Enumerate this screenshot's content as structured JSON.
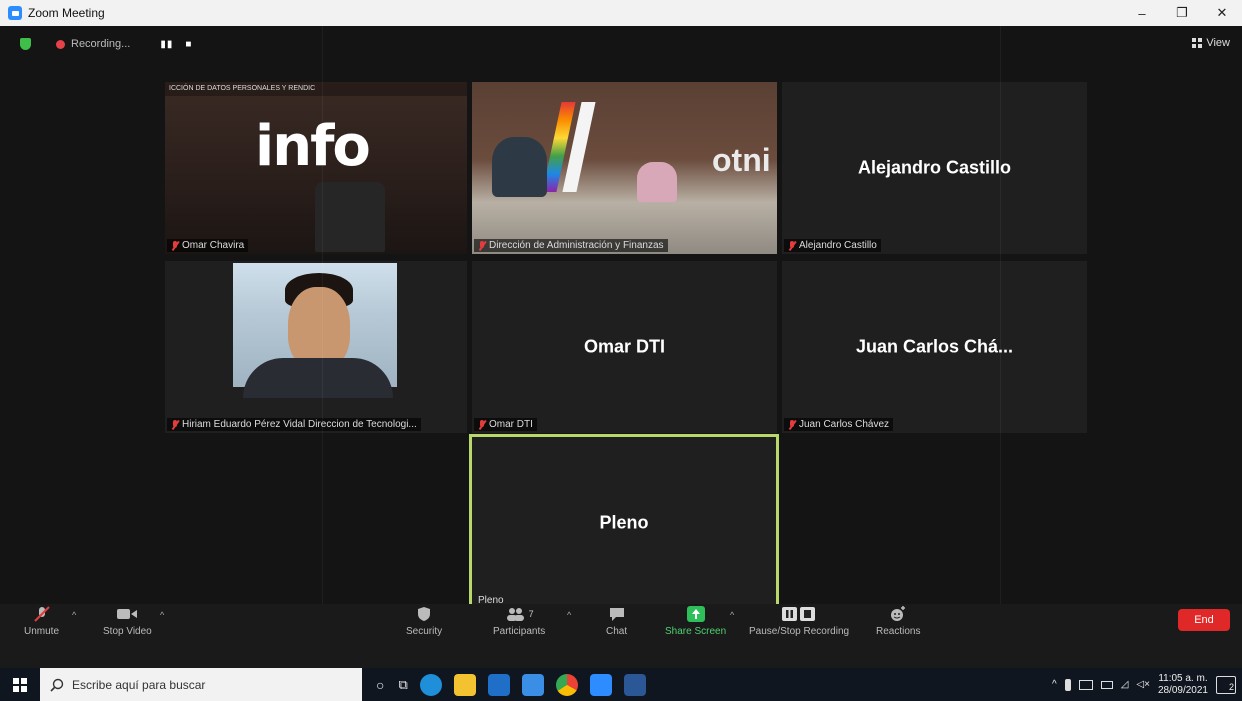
{
  "window": {
    "title": "Zoom Meeting",
    "minimize": "–",
    "restore": "❐",
    "close": "✕"
  },
  "topbar": {
    "recording_label": "Recording...",
    "pause_icon": "▮▮",
    "stop_icon": "■",
    "view_label": "View"
  },
  "tiles": {
    "omar_chavira": {
      "name": "Omar Chavira",
      "banner": "ICCIÓN DE DATOS PERSONALES Y RENDIC",
      "logo": "info"
    },
    "direccion": {
      "name": "Dirección de Administración y Finanzas",
      "sign": "otni"
    },
    "alejandro": {
      "center_name": "Alejandro Castillo",
      "name": "Alejandro Castillo"
    },
    "hiriam": {
      "name": "Hiriam Eduardo Pérez Vidal Direccion de Tecnologi..."
    },
    "omar_dti": {
      "center_name": "Omar DTI",
      "name": "Omar DTI"
    },
    "juan_carlos": {
      "center_name": "Juan Carlos Chá...",
      "name": "Juan Carlos Chávez"
    },
    "pleno": {
      "center_name": "Pleno",
      "name": "Pleno"
    }
  },
  "controls": {
    "unmute": "Unmute",
    "stop_video": "Stop Video",
    "security": "Security",
    "participants": "Participants",
    "participants_count": "7",
    "chat": "Chat",
    "share_screen": "Share Screen",
    "pause_stop_recording": "Pause/Stop Recording",
    "reactions": "Reactions",
    "end": "End"
  },
  "taskbar": {
    "search_placeholder": "Escribe aquí para buscar",
    "time": "11:05 a. m.",
    "date": "28/09/2021",
    "notification_count": "2"
  },
  "colors": {
    "accent": "#2d8cff",
    "end_red": "#e02828",
    "active_speaker": "#b8d86a",
    "share_green": "#2fbf5a"
  }
}
